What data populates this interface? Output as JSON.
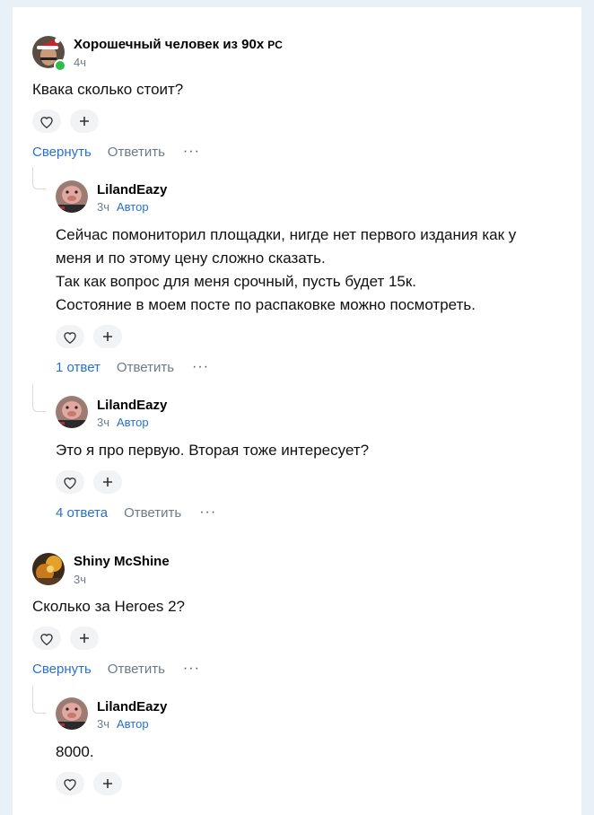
{
  "comments": [
    {
      "author": "Хорошечный человек из 90х",
      "author_badge": "PC",
      "time": "4ч",
      "text": "Квака сколько стоит?",
      "primary_action": "Свернуть",
      "reply": "Ответить",
      "more": "···"
    },
    {
      "author": "LilandEazy",
      "time": "3ч",
      "badge": "Автор",
      "lines": [
        "Сейчас помониторил площадки, нигде нет первого издания как у",
        "меня и по этому цену сложно сказать.",
        "Так как вопрос для меня срочный, пусть будет 15к.",
        "Состояние в моем посте по распаковке можно посмотреть."
      ],
      "primary_action": "1 ответ",
      "reply": "Ответить",
      "more": "···"
    },
    {
      "author": "LilandEazy",
      "time": "3ч",
      "badge": "Автор",
      "text": "Это я про первую. Вторая тоже интересует?",
      "primary_action": "4 ответа",
      "reply": "Ответить",
      "more": "···"
    },
    {
      "author": "Shiny McShine",
      "time": "3ч",
      "text": "Сколько за Heroes 2?",
      "primary_action": "Свернуть",
      "reply": "Ответить",
      "more": "···"
    },
    {
      "author": "LilandEazy",
      "time": "3ч",
      "badge": "Автор",
      "text": "8000."
    }
  ],
  "reactions": {
    "like_icon": "heart-outline-icon",
    "add_icon": "plus-icon"
  },
  "colors": {
    "link": "#2a70c9",
    "muted": "#6f7985",
    "online": "#2ebd49",
    "background": "#e8f1f8"
  }
}
